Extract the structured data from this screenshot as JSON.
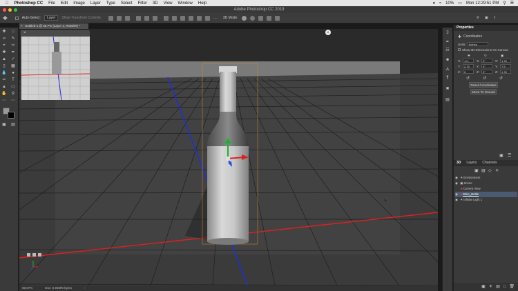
{
  "menubar": {
    "apple_icon": "apple-icon",
    "app_name": "Photoshop CC",
    "items": [
      "File",
      "Edit",
      "Image",
      "Layer",
      "Type",
      "Select",
      "Filter",
      "3D",
      "View",
      "Window",
      "Help"
    ],
    "status": {
      "battery": "10%",
      "clock": "Mon 12:29:51 PM"
    }
  },
  "window": {
    "title": "Adobe Photoshop CC 2019"
  },
  "options": {
    "auto_select_label": "Auto-Select:",
    "auto_select_value": "Layer",
    "show_transform": "Show Transform Controls",
    "mode_3d": "3D Mode:"
  },
  "document": {
    "tab": "Untitled-1 @ 66.7% (Layer 1, RGB/8#) *",
    "zoom": "66.67%",
    "doc_info": "Doc: 5.93M/0 bytes"
  },
  "properties": {
    "header": "Properties",
    "section": "Coordinates",
    "units_label": "Units:",
    "units_value": "Inches",
    "show_3d_dims": "Show 3D Dimensions On Canvas",
    "coords": {
      "x": {
        "label": "X:",
        "val": "-0.1"
      },
      "y": {
        "label": "Y:",
        "val": "2.75"
      },
      "z": {
        "label": "Z:",
        "val": "0"
      },
      "rx": {
        "label": "X:",
        "val": "0°"
      },
      "ry": {
        "label": "Y:",
        "val": "0°"
      },
      "rz": {
        "label": "Z:",
        "val": "0°"
      },
      "sx": {
        "label": "X:",
        "val": "1.78"
      },
      "sy": {
        "label": "Y:",
        "val": "7.5"
      },
      "sz": {
        "label": "Z:",
        "val": "1.78"
      }
    },
    "reset_btn": "Reset Coordinates",
    "move_btn": "Move To Ground"
  },
  "layers_panel": {
    "tabs": [
      "3D",
      "Layers",
      "Channels"
    ],
    "items": [
      {
        "label": "Environment",
        "indent": 0
      },
      {
        "label": "Scene",
        "indent": 0
      },
      {
        "label": "Current View",
        "indent": 1
      },
      {
        "label": "Wine_Bottle",
        "indent": 1,
        "selected": true
      },
      {
        "label": "Infinite Light 1",
        "indent": 1
      }
    ]
  },
  "colors": {
    "axis_x": "#e02020",
    "axis_y": "#2030d0",
    "axis_z": "#20b030",
    "accent": "#4b5a70"
  }
}
